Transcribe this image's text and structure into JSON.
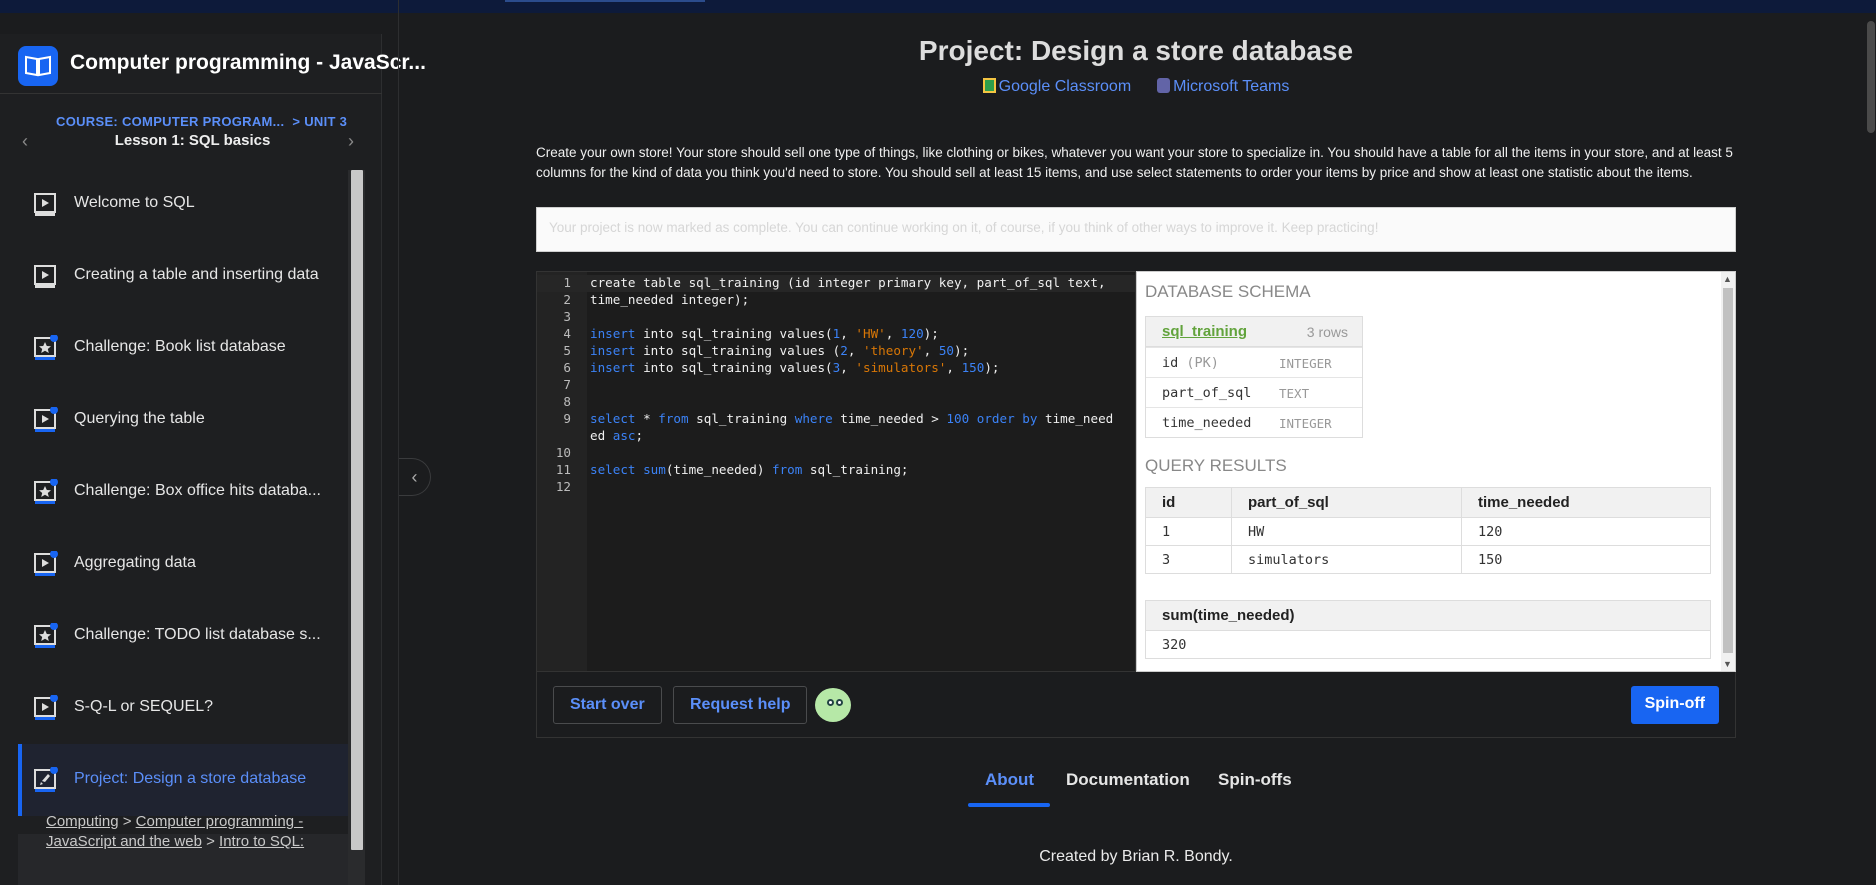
{
  "sidebar": {
    "course_title": "Computer programming - JavaScr...",
    "breadcrumb_course": "COURSE: COMPUTER PROGRAM...",
    "breadcrumb_unit": "> UNIT 3",
    "lesson_title": "Lesson 1: SQL basics",
    "items": [
      {
        "label": "Welcome to SQL",
        "icon": "video-icon"
      },
      {
        "label": "Creating a table and inserting data",
        "icon": "video-icon"
      },
      {
        "label": "Challenge: Book list database",
        "icon": "challenge-star-icon"
      },
      {
        "label": "Querying the table",
        "icon": "video-icon"
      },
      {
        "label": "Challenge: Box office hits databa...",
        "icon": "challenge-star-icon"
      },
      {
        "label": "Aggregating data",
        "icon": "video-icon"
      },
      {
        "label": "Challenge: TODO list database s...",
        "icon": "challenge-star-icon"
      },
      {
        "label": "S-Q-L or SEQUEL?",
        "icon": "video-icon"
      },
      {
        "label": "Project: Design a store database",
        "icon": "project-rocket-icon"
      }
    ],
    "footer_crumbs": {
      "c1": "Computing",
      "sep": ">",
      "c2": "Computer programming -",
      "c3": "JavaScript and the web",
      "c4": "Intro to SQL:"
    }
  },
  "main": {
    "title": "Project: Design a store database",
    "share_google": "Google Classroom",
    "share_teams": "Microsoft Teams",
    "description": "Create your own store! Your store should sell one type of things, like clothing or bikes, whatever you want your store to specialize in. You should have a table for all the items in your store, and at least 5 columns for the kind of data you think you'd need to store. You should sell at least 15 items, and use select statements to order your items by price and show at least one statistic about the items.",
    "completion_note": "Your project is now marked as complete. You can continue working on it, of course, if you think of other ways to improve it. Keep practicing!",
    "code_lines": [
      "1",
      "2",
      "3",
      "4",
      "5",
      "6",
      "7",
      "8",
      "9",
      "10",
      "11",
      "12"
    ],
    "results": {
      "schema_heading": "DATABASE SCHEMA",
      "table_name": "sql_training",
      "row_count": "3 rows",
      "columns": [
        {
          "name": "id",
          "pk": "(PK)",
          "type": "INTEGER"
        },
        {
          "name": "part_of_sql",
          "pk": "",
          "type": "TEXT"
        },
        {
          "name": "time_needed",
          "pk": "",
          "type": "INTEGER"
        }
      ],
      "query_heading": "QUERY RESULTS",
      "q1_headers": [
        "id",
        "part_of_sql",
        "time_needed"
      ],
      "q1_rows": [
        [
          "1",
          "HW",
          "120"
        ],
        [
          "3",
          "simulators",
          "150"
        ]
      ],
      "q2_header": "sum(time_needed)",
      "q2_value": "320"
    },
    "buttons": {
      "start_over": "Start over",
      "request_help": "Request help",
      "spin_off": "Spin-off"
    },
    "tabs": [
      "About",
      "Documentation",
      "Spin-offs"
    ],
    "created_by": "Created by Brian R. Bondy."
  },
  "colors": {
    "accent": "#1865f2",
    "link": "#5b8ff9",
    "schema_table": "#62a33c"
  }
}
